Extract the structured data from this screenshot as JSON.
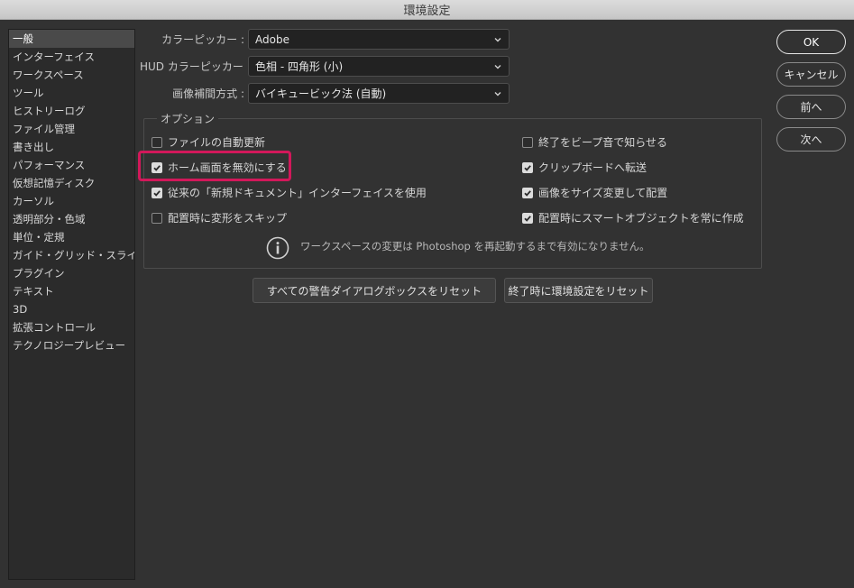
{
  "window": {
    "title": "環境設定"
  },
  "sidebar": {
    "items": [
      {
        "label": "一般",
        "selected": true
      },
      {
        "label": "インターフェイス"
      },
      {
        "label": "ワークスペース"
      },
      {
        "label": "ツール"
      },
      {
        "label": "ヒストリーログ"
      },
      {
        "label": "ファイル管理"
      },
      {
        "label": "書き出し"
      },
      {
        "label": "パフォーマンス"
      },
      {
        "label": "仮想記憶ディスク"
      },
      {
        "label": "カーソル"
      },
      {
        "label": "透明部分・色域"
      },
      {
        "label": "単位・定規"
      },
      {
        "label": "ガイド・グリッド・スライス"
      },
      {
        "label": "プラグイン"
      },
      {
        "label": "テキスト"
      },
      {
        "label": "3D"
      },
      {
        "label": "拡張コントロール"
      },
      {
        "label": "テクノロジープレビュー"
      }
    ]
  },
  "fields": {
    "color_picker": {
      "label": "カラーピッカー :",
      "value": "Adobe"
    },
    "hud_color_picker": {
      "label": "HUD カラーピッカー :",
      "value": "色相 - 四角形 (小)"
    },
    "interpolation": {
      "label": "画像補間方式 :",
      "value": "バイキュービック法 (自動)"
    }
  },
  "options": {
    "legend": "オプション",
    "left": [
      {
        "label": "ファイルの自動更新",
        "checked": false
      },
      {
        "label": "ホーム画面を無効にする",
        "checked": true
      },
      {
        "label": "従来の「新規ドキュメント」インターフェイスを使用",
        "checked": true
      },
      {
        "label": "配置時に変形をスキップ",
        "checked": false
      }
    ],
    "right": [
      {
        "label": "終了をビープ音で知らせる",
        "checked": false
      },
      {
        "label": "クリップボードへ転送",
        "checked": true
      },
      {
        "label": "画像をサイズ変更して配置",
        "checked": true
      },
      {
        "label": "配置時にスマートオブジェクトを常に作成",
        "checked": true
      }
    ],
    "notice": "ワークスペースの変更は Photoshop を再起動するまで有効になりません。"
  },
  "buttons": {
    "reset_warnings": "すべての警告ダイアログボックスをリセット",
    "reset_prefs": "終了時に環境設定をリセット",
    "ok": "OK",
    "cancel": "キャンセル",
    "prev": "前へ",
    "next": "次へ"
  },
  "colors": {
    "background": "#323232",
    "highlight": "#d2185a",
    "checkbox_on": "#dcdcdc"
  },
  "icons": {
    "select_arrow": "chevron-down-icon",
    "checkbox": "checkmark-icon",
    "info": "info-icon"
  }
}
